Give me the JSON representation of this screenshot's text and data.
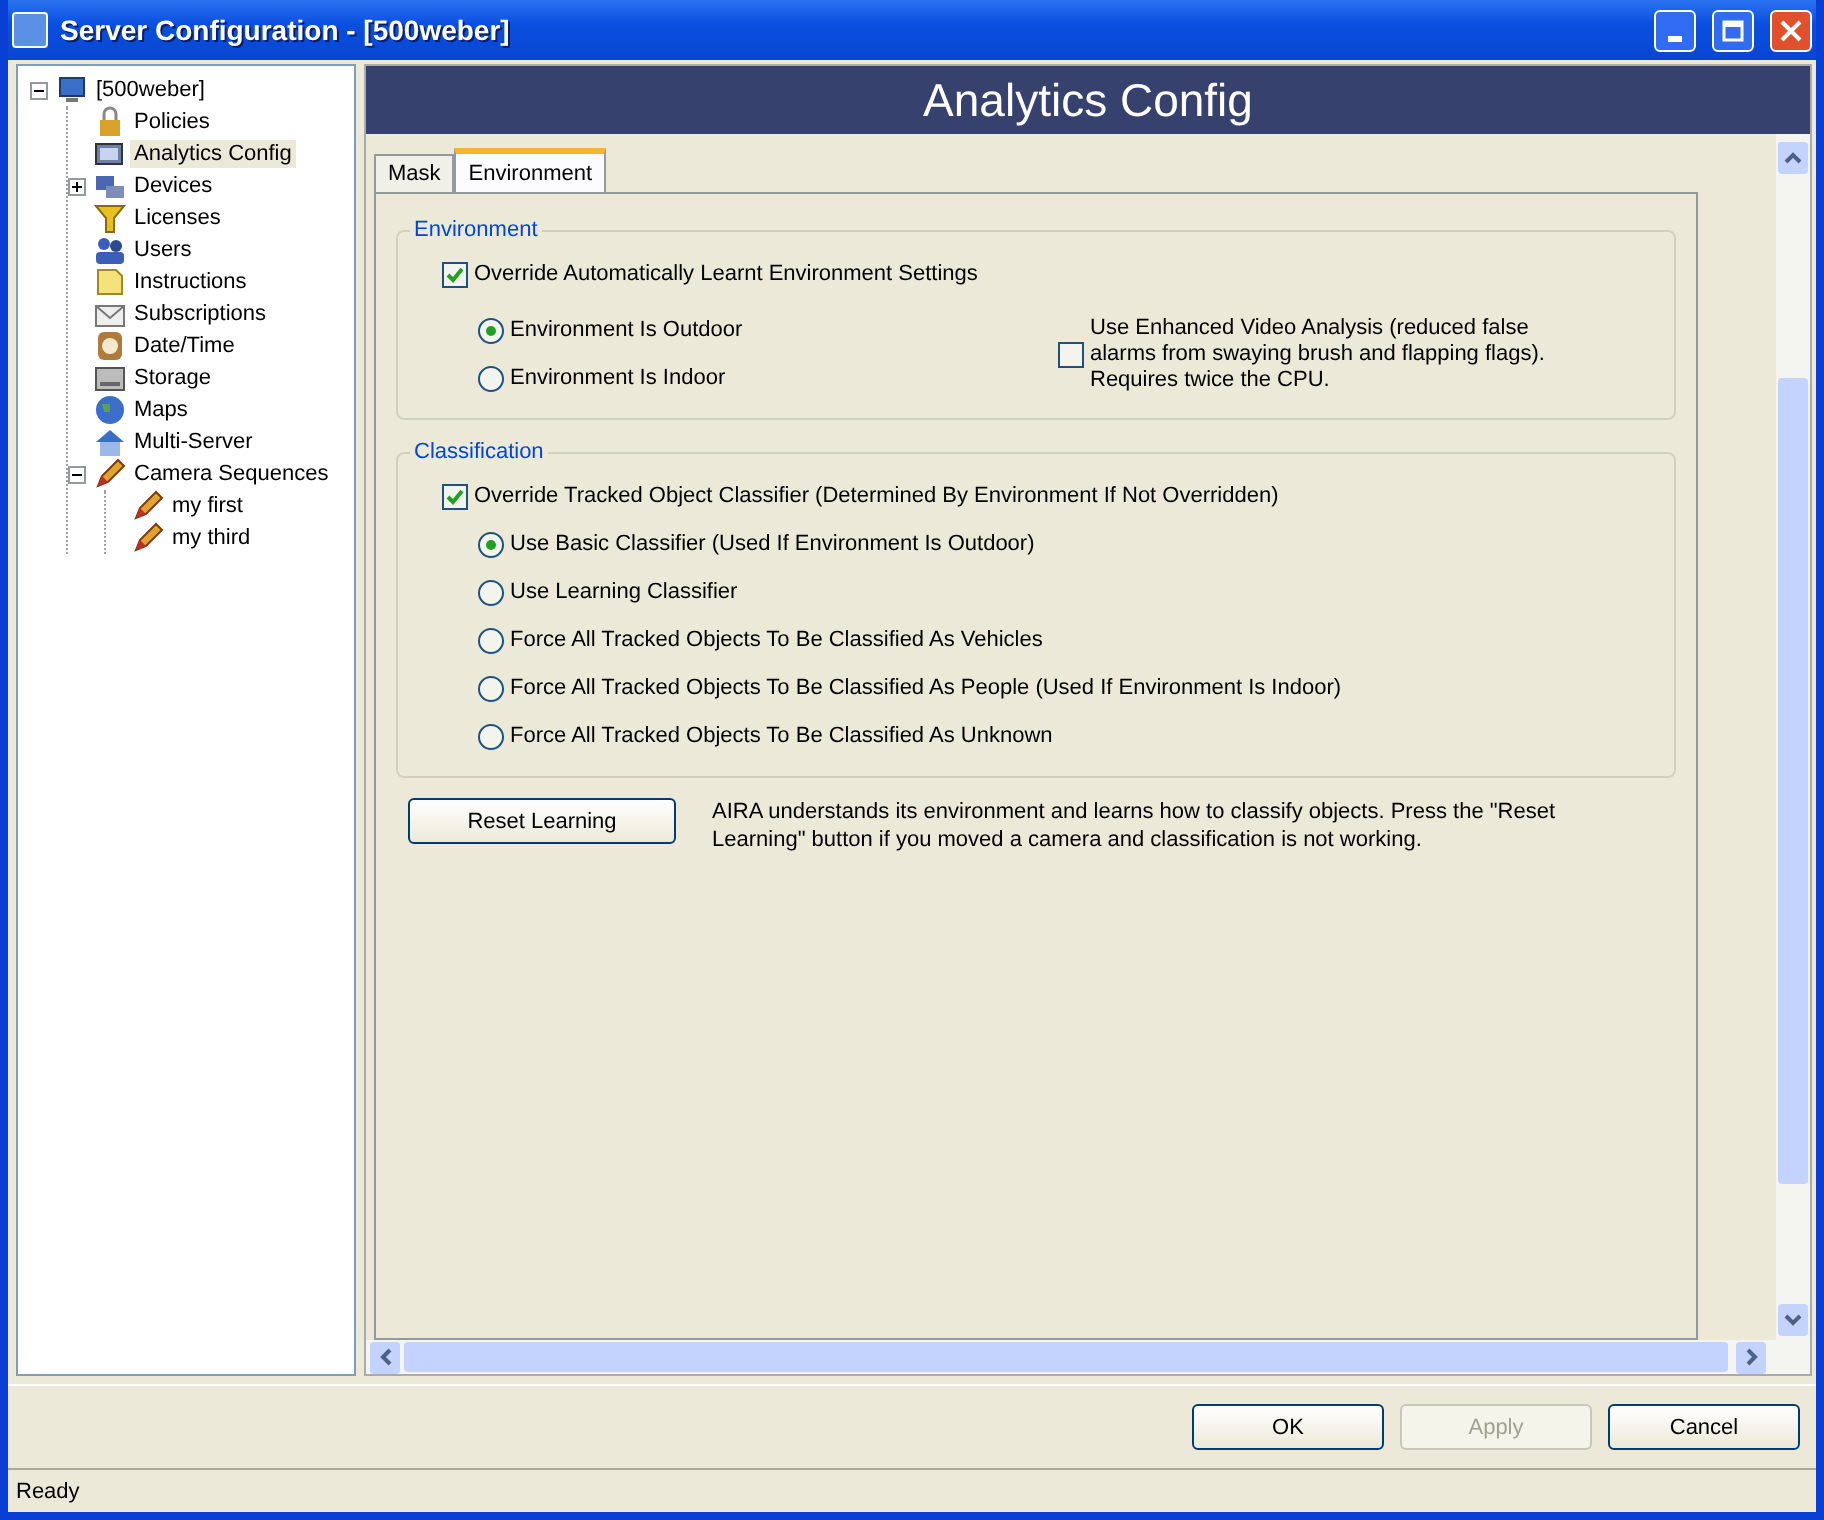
{
  "window": {
    "title": "Server Configuration - [500weber]"
  },
  "tree": [
    {
      "label": "[500weber]",
      "expanded": true,
      "selected": false,
      "children": [
        {
          "label": "Policies",
          "selected": false
        },
        {
          "label": "Analytics Config",
          "selected": true
        },
        {
          "label": "Devices",
          "expanded": false,
          "selected": false
        },
        {
          "label": "Licenses",
          "selected": false
        },
        {
          "label": "Users",
          "selected": false
        },
        {
          "label": "Instructions",
          "selected": false
        },
        {
          "label": "Subscriptions",
          "selected": false
        },
        {
          "label": "Date/Time",
          "selected": false
        },
        {
          "label": "Storage",
          "selected": false
        },
        {
          "label": "Maps",
          "selected": false
        },
        {
          "label": "Multi-Server",
          "selected": false
        },
        {
          "label": "Camera Sequences",
          "expanded": true,
          "selected": false,
          "children": [
            {
              "label": "my first",
              "selected": false
            },
            {
              "label": "my third",
              "selected": false
            }
          ]
        }
      ]
    }
  ],
  "header": {
    "title": "Analytics Config"
  },
  "tabs": [
    {
      "label": "Mask",
      "selected": false
    },
    {
      "label": "Environment",
      "selected": true
    }
  ],
  "environment": {
    "title": "Environment",
    "override": {
      "label": "Override Automatically Learnt Environment Settings",
      "checked": true
    },
    "options": [
      {
        "label": "Environment Is Outdoor",
        "selected": true
      },
      {
        "label": "Environment Is Indoor",
        "selected": false
      }
    ],
    "enhanced": {
      "label": "Use Enhanced Video Analysis (reduced false alarms from swaying brush and flapping flags). Requires twice the CPU.",
      "checked": false
    }
  },
  "classification": {
    "title": "Classification",
    "override": {
      "label": "Override Tracked Object Classifier (Determined By Environment If Not Overridden)",
      "checked": true
    },
    "options": [
      {
        "label": "Use Basic Classifier (Used If Environment Is Outdoor)",
        "selected": true
      },
      {
        "label": "Use Learning Classifier",
        "selected": false
      },
      {
        "label": "Force All Tracked Objects To Be Classified As Vehicles",
        "selected": false
      },
      {
        "label": "Force All Tracked Objects To Be Classified As People (Used If Environment Is Indoor)",
        "selected": false
      },
      {
        "label": "Force All Tracked Objects To Be Classified As Unknown",
        "selected": false
      }
    ]
  },
  "reset": {
    "button": "Reset Learning",
    "note": "AIRA understands its environment and learns how to classify objects.  Press the \"Reset Learning\" button if you moved a camera and classification is not working."
  },
  "buttons": [
    {
      "label": "OK",
      "disabled": false
    },
    {
      "label": "Apply",
      "disabled": true
    },
    {
      "label": "Cancel",
      "disabled": false
    }
  ],
  "status_bar": "Ready"
}
